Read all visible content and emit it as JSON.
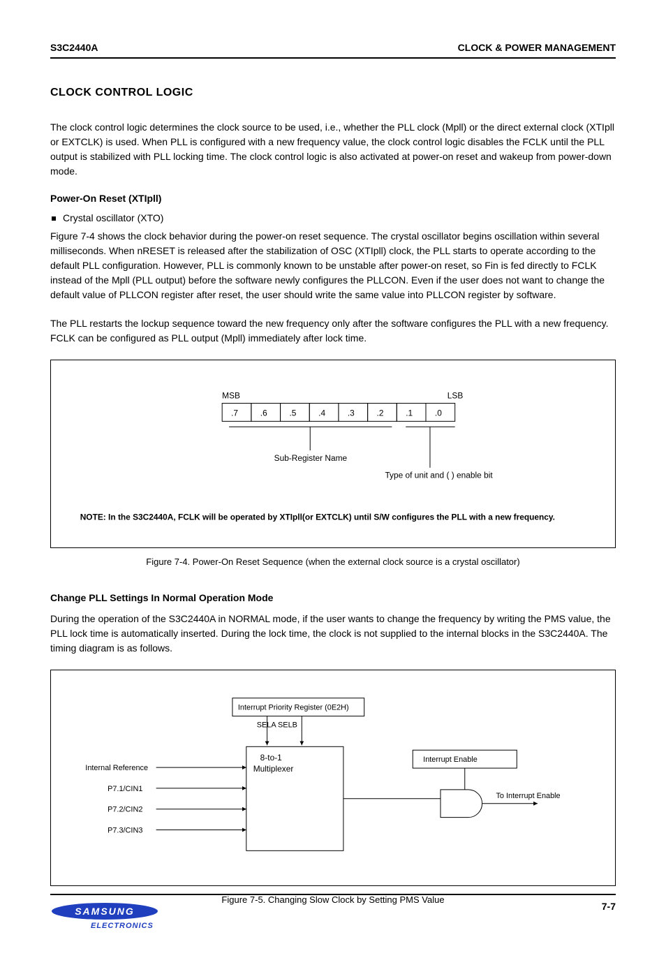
{
  "header": {
    "left": "S3C2440A",
    "right": "CLOCK & POWER MANAGEMENT"
  },
  "section_title": "CLOCK CONTROL LOGIC",
  "para_intro": "The clock control logic determines the clock source to be used, i.e., whether the PLL clock (Mpll) or the direct external clock (XTIpll or EXTCLK) is used. When PLL is configured with a new frequency value, the clock control logic disables the FCLK until the PLL output is stabilized with PLL locking time. The clock control logic is also activated at power-on reset and wakeup from power-down mode.",
  "sub1": "Power-On Reset (XTIpll)",
  "bullet1_text": "Crystal oscillator (XTO)",
  "para_sub1": "Figure 7-4 shows the clock behavior during the power-on reset sequence. The crystal oscillator begins oscillation within several milliseconds. When nRESET is released after the stabilization of OSC (XTIpll) clock, the PLL starts to operate according to the default PLL configuration. However, PLL is commonly known to be unstable after power-on reset, so Fin is fed directly to FCLK instead of the Mpll (PLL output) before the software newly configures the PLLCON. Even if the user does not want to change the default value of PLLCON register after reset, the user should write the same value into PLLCON register by software.",
  "para_sub1b": "The PLL restarts the lockup sequence toward the new frequency only after the software configures the PLL with a new frequency. FCLK can be configured as PLL output (Mpll) immediately after lock time.",
  "fig1": {
    "msb": "MSB",
    "lsb": "LSB",
    "bit7": ".7",
    "bit6": ".6",
    "bit5": ".5",
    "bit4": ".4",
    "bit3": ".3",
    "bit2": ".2",
    "bit1": ".1",
    "bit0": ".0",
    "annot_sub": "Sub-Register Name",
    "annot_type": "Type of unit and ( ) enable bit",
    "note": "NOTE:   In the S3C2440A, FCLK will be operated by XTIpll(or EXTCLK) until S/W configures the PLL with a new frequency.",
    "caption": "Figure 7-4. Power-On Reset Sequence (when the external clock source is a crystal oscillator)"
  },
  "sub2": "Change PLL Settings In Normal Operation Mode",
  "para_sub2": "During the operation of the S3C2440A in NORMAL mode, if the user wants to change the frequency by writing the PMS value, the PLL lock time is automatically inserted. During the lock time, the clock is not supplied to the internal blocks in the S3C2440A. The timing diagram is as follows.",
  "fig2": {
    "top_box": "Interrupt Priority Register (0E2H)",
    "sel": "SELA  SELB",
    "mux_title": "8-to-1 Multiplexer",
    "in_a": "Internal Reference",
    "in_b": "P7.1/CIN1",
    "in_c": "P7.2/CIN2",
    "in_d": "P7.3/CIN3",
    "interrupt_box": "Interrupt Enable",
    "out": "To Interrupt Enable",
    "caption": "Figure 7-5. Changing Slow Clock by Setting PMS Value"
  },
  "footer": {
    "page": "7-7",
    "brand": "SAMSUNG",
    "sub": "ELECTRONICS"
  }
}
